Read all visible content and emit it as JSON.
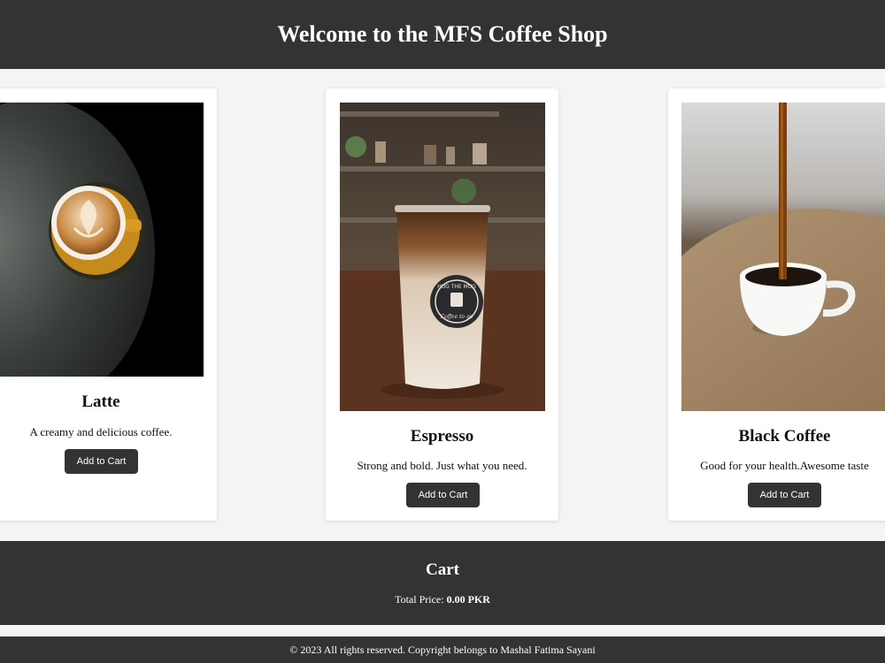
{
  "header": {
    "title": "Welcome to the MFS Coffee Shop"
  },
  "products": [
    {
      "name": "Latte",
      "description": "A creamy and delicious coffee.",
      "button": "Add to Cart",
      "image": "latte-art-photo"
    },
    {
      "name": "Espresso",
      "description": "Strong and bold. Just what you need.",
      "button": "Add to Cart",
      "image": "iced-coffee-cup-photo",
      "cup_logo_top": "HUG THE MUG",
      "cup_logo_bottom": "Coffee to go"
    },
    {
      "name": "Black Coffee",
      "description": "Good for your health.Awesome taste",
      "button": "Add to Cart",
      "image": "pouring-black-coffee-photo"
    }
  ],
  "cart": {
    "title": "Cart",
    "total_label": "Total Price:",
    "total_value": "0.00 PKR"
  },
  "footer": {
    "text": "© 2023 All rights reserved. Copyright belongs to Mashal Fatima Sayani"
  },
  "colors": {
    "header_bg": "#333333",
    "page_bg": "#f4f4f4",
    "card_bg": "#ffffff",
    "button_bg": "#333333"
  }
}
